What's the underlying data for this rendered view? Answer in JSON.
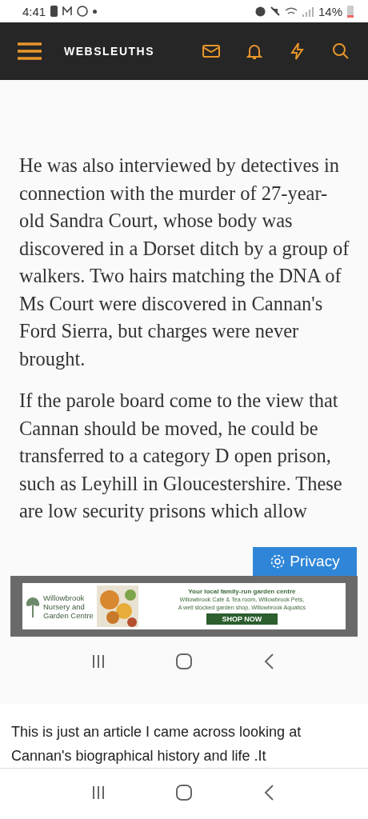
{
  "status_bar": {
    "time": "4:41",
    "battery": "14%"
  },
  "header": {
    "logo": "WEBSLEUTHS"
  },
  "screenshot": {
    "paragraphs": [
      "He was also interviewed by detectives in connection with the murder of 27-year-old Sandra Court, whose body was discovered in a Dorset ditch by a group of walkers. Two hairs matching the DNA of Ms Court were discovered in Cannan's Ford Sierra, but charges were never brought.",
      "If the parole board come to the view that Cannan should be moved, he could be transferred to a category D open prison, such as Leyhill in Gloucestershire. These are low security prisons which allow"
    ],
    "privacy": "Privacy",
    "ad": {
      "logo_lines": [
        "Willowbrook",
        "Nursery and",
        "Garden Centre"
      ],
      "headline": "Your local family-run garden centre",
      "body_lines": [
        "Willowbrook Cafe & Tea room, Willowbrook Pets,",
        "A well stocked garden shop, Willowbrook Aquatics"
      ],
      "cta": "SHOP NOW"
    }
  },
  "post": {
    "text": "This is just an article I came across looking at Cannan's biographical history and life .It"
  }
}
